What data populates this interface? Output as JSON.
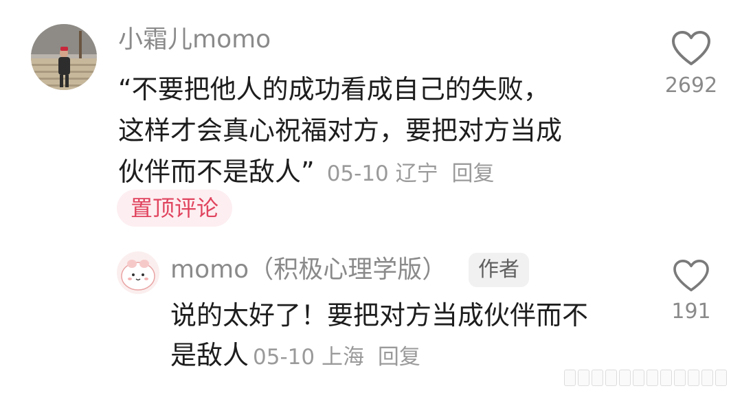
{
  "main_comment": {
    "username": "小霜儿momo",
    "avatar": "user-avatar",
    "text_lines": [
      "“不要把他人的成功看成自己的失败，",
      "这样才会真心祝福对方，要把对方当成",
      "伙伴而不是敌人”"
    ],
    "date": "05-10",
    "location": "辽宁",
    "reply_label": "回复",
    "pinned_label": "置顶评论",
    "likes": "2692"
  },
  "reply_comment": {
    "username": "momo（积极心理学版）",
    "author_badge": "作者",
    "avatar": "author-avatar",
    "text_lines": [
      "说的太好了！要把对方当成伙伴而不",
      "是敌人"
    ],
    "date": "05-10",
    "location": "上海",
    "reply_label": "回复",
    "likes": "191"
  },
  "icons": {
    "like": "heart-outline-icon"
  },
  "colors": {
    "pinned_bg": "#fdeef1",
    "pinned_text": "#e0445e",
    "meta_gray": "#9a9a9a",
    "badge_bg": "#f1f1f1"
  }
}
